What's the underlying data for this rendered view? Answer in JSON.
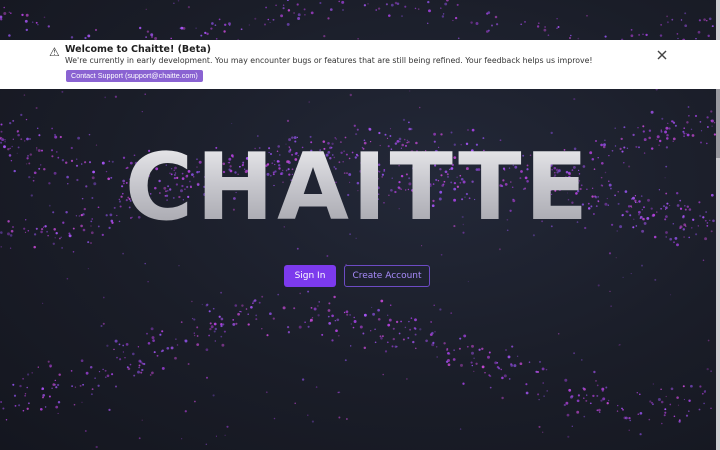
{
  "banner": {
    "warning_icon": "warning-triangle-icon",
    "title": "Welcome to Chaitte! (Beta)",
    "message": "We're currently in early development. You may encounter bugs or features that are still being refined. Your feedback helps us improve!",
    "support_label": "Contact Support (support@chaitte.com)",
    "close_icon": "close-icon"
  },
  "hero": {
    "logo_text": "CHAITTE",
    "sign_in_label": "Sign In",
    "create_account_label": "Create Account"
  },
  "colors": {
    "background": "#1a1d28",
    "accent": "#7c3aed",
    "accent_light": "#a78bfa",
    "particle": "#b040d8"
  }
}
